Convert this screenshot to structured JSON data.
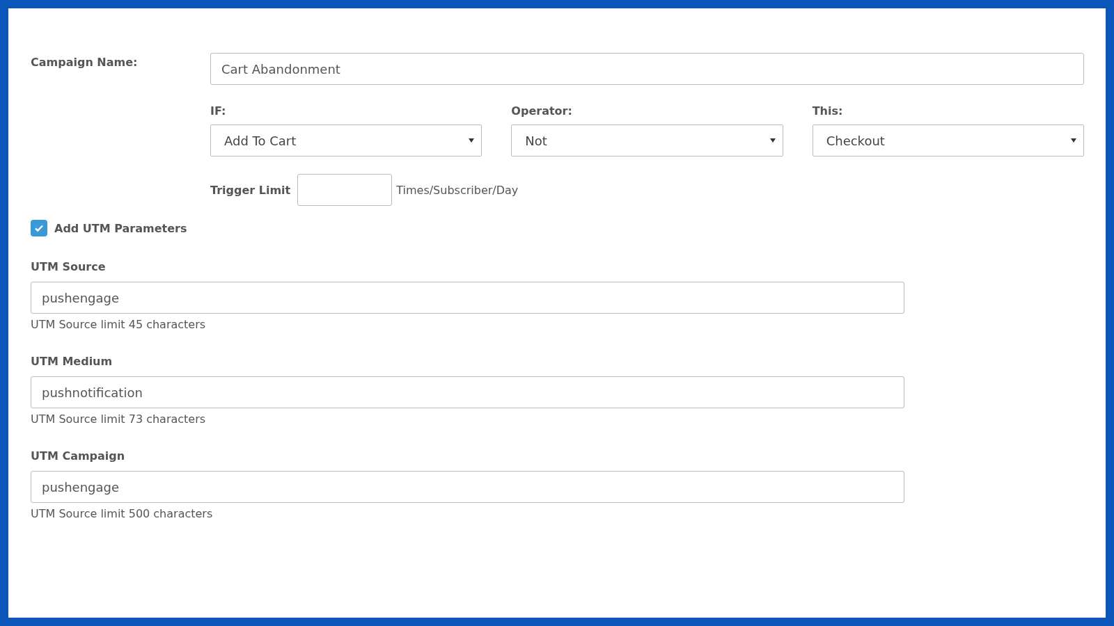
{
  "campaign_name": {
    "label": "Campaign Name:",
    "value": "Cart Abandonment"
  },
  "conditions": [
    {
      "label": "IF:",
      "value": "Add To Cart"
    },
    {
      "label": "Operator:",
      "value": "Not"
    },
    {
      "label": "This:",
      "value": "Checkout"
    }
  ],
  "trigger_limit": {
    "label": "Trigger Limit",
    "suffix": "Times/Subscriber/Day"
  },
  "utm_toggle": {
    "label": "Add UTM Parameters",
    "checked": true
  },
  "utm_fields": [
    {
      "label": "UTM Source",
      "value": "pushengage",
      "hint": "UTM Source limit 45 characters"
    },
    {
      "label": "UTM Medium",
      "value": "pushnotification",
      "hint": "UTM Source limit 73 characters"
    },
    {
      "label": "UTM Campaign",
      "value": "pushengage",
      "hint": "UTM Source limit 500 characters"
    }
  ]
}
